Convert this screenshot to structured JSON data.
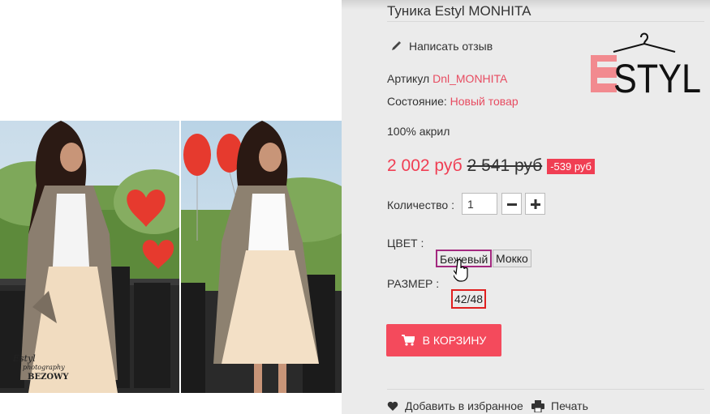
{
  "product": {
    "title": "Туника Estyl MONHITA",
    "write_review": "Написать отзыв",
    "sku_label": "Артикул",
    "sku_value": "Dnl_MONHITA",
    "condition_label": "Состояние:",
    "condition_value": "Новый товар",
    "composition": "100% акрил"
  },
  "brand": {
    "logo_text": "ESTYL"
  },
  "photo": {
    "caption_line1": "Estyl",
    "caption_line2": "photography",
    "caption_line3": "BEZOWY"
  },
  "price": {
    "current": "2 002 руб",
    "old": "2 541 руб",
    "discount": "-539 руб"
  },
  "quantity": {
    "label": "Количество :",
    "value": "1"
  },
  "color": {
    "label": "ЦВЕТ :",
    "options": [
      "Бежевый",
      "Мокко"
    ],
    "selected": "Бежевый"
  },
  "size": {
    "label": "РАЗМЕР :",
    "options": [
      "42/48"
    ]
  },
  "actions": {
    "add_to_cart": "В КОРЗИНУ",
    "wishlist": "Добавить в избранное",
    "print": "Печать"
  },
  "icons": {
    "review": "pencil-icon",
    "cart": "cart-icon",
    "wishlist": "heart-icon",
    "print": "printer-icon",
    "cursor": "hand-pointer-icon"
  },
  "colors": {
    "accent": "#f03e53",
    "button": "#f44a5c",
    "link": "#e74c61",
    "selected_border": "#a3297f",
    "size_border": "#e02020"
  }
}
